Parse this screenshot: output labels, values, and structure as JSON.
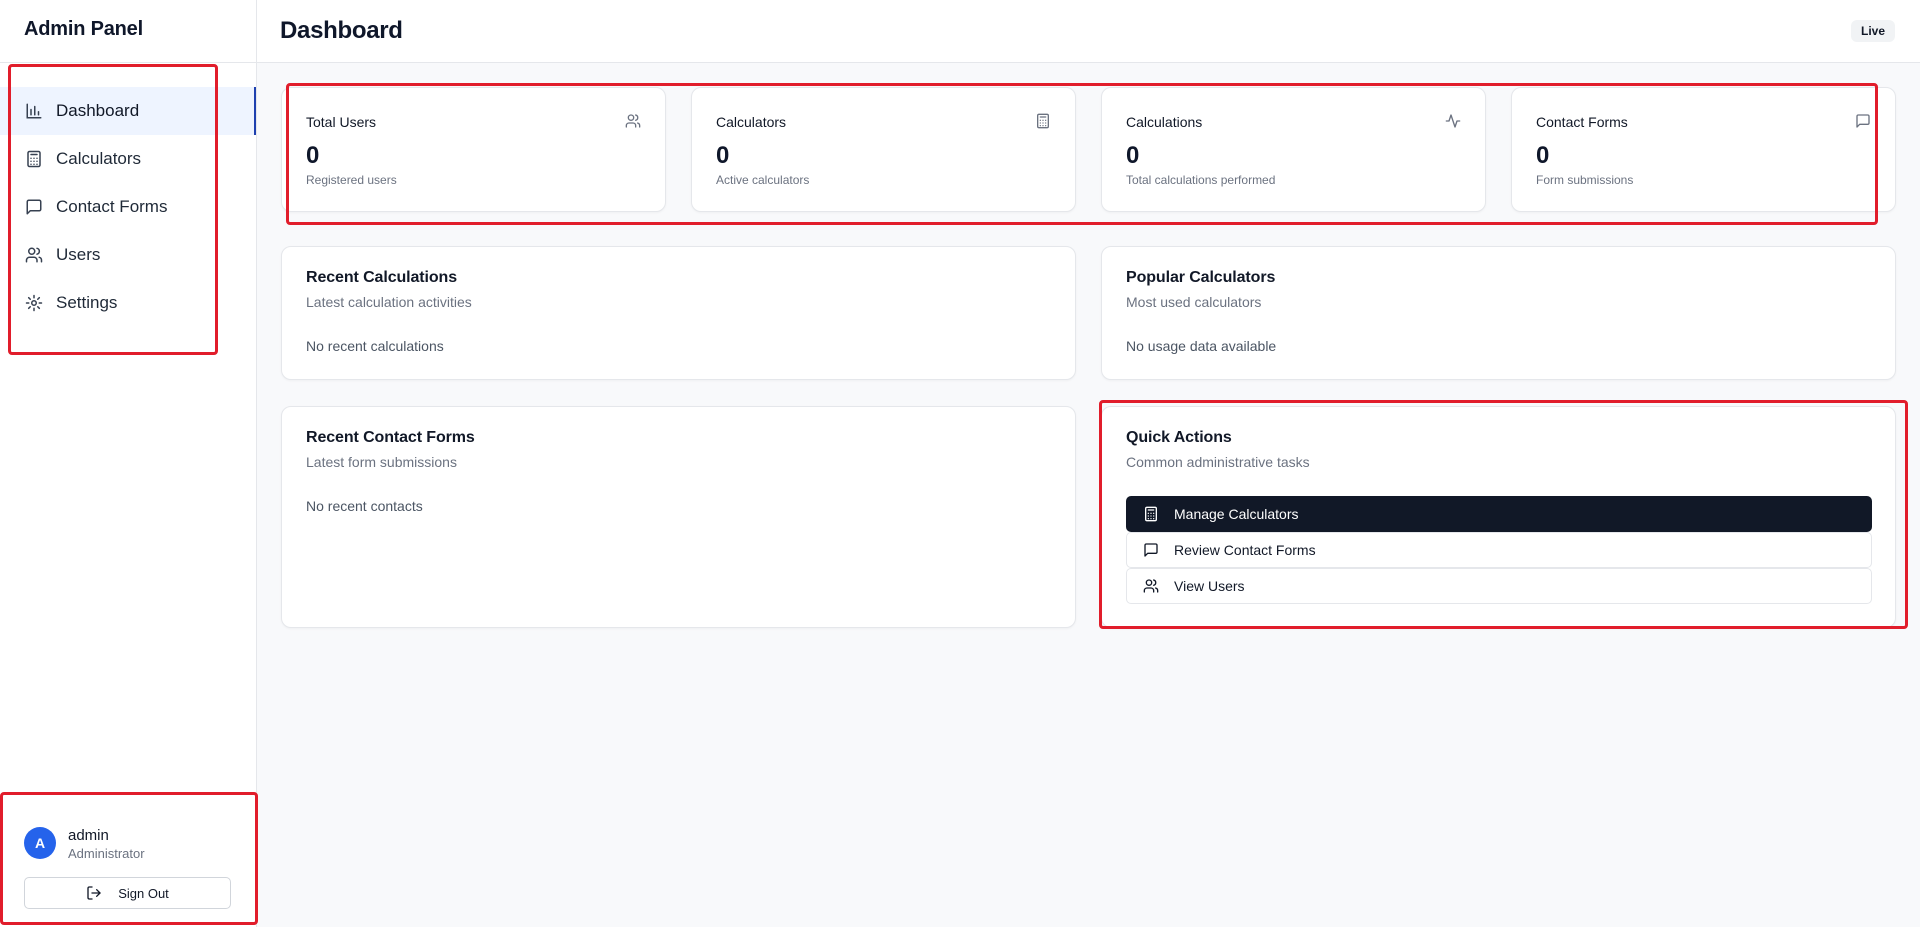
{
  "sidebar": {
    "brand": "Admin Panel",
    "items": [
      {
        "label": "Dashboard",
        "icon": "bar-chart-icon",
        "active": true
      },
      {
        "label": "Calculators",
        "icon": "calculator-icon"
      },
      {
        "label": "Contact Forms",
        "icon": "message-square-icon"
      },
      {
        "label": "Users",
        "icon": "users-icon"
      },
      {
        "label": "Settings",
        "icon": "gear-icon"
      }
    ],
    "user": {
      "initial": "A",
      "name": "admin",
      "role": "Administrator"
    },
    "signout_label": "Sign Out"
  },
  "header": {
    "title": "Dashboard",
    "badge": "Live"
  },
  "stats": [
    {
      "title": "Total Users",
      "value": "0",
      "sub": "Registered users",
      "icon": "users-icon"
    },
    {
      "title": "Calculators",
      "value": "0",
      "sub": "Active calculators",
      "icon": "calculator-icon"
    },
    {
      "title": "Calculations",
      "value": "0",
      "sub": "Total calculations performed",
      "icon": "activity-icon"
    },
    {
      "title": "Contact Forms",
      "value": "0",
      "sub": "Form submissions",
      "icon": "message-square-icon"
    }
  ],
  "panels": {
    "recent_calculations": {
      "title": "Recent Calculations",
      "sub": "Latest calculation activities",
      "empty": "No recent calculations"
    },
    "popular_calculators": {
      "title": "Popular Calculators",
      "sub": "Most used calculators",
      "empty": "No usage data available"
    },
    "recent_contacts": {
      "title": "Recent Contact Forms",
      "sub": "Latest form submissions",
      "empty": "No recent contacts"
    },
    "quick_actions": {
      "title": "Quick Actions",
      "sub": "Common administrative tasks",
      "buttons": [
        {
          "label": "Manage Calculators",
          "icon": "calculator-icon"
        },
        {
          "label": "Review Contact Forms",
          "icon": "message-square-icon"
        },
        {
          "label": "View Users",
          "icon": "users-icon"
        }
      ]
    }
  },
  "colors": {
    "accent": "#2563eb",
    "active_bg": "#eef4ff",
    "primary_button": "#111827",
    "highlight": "#e11d2b"
  }
}
